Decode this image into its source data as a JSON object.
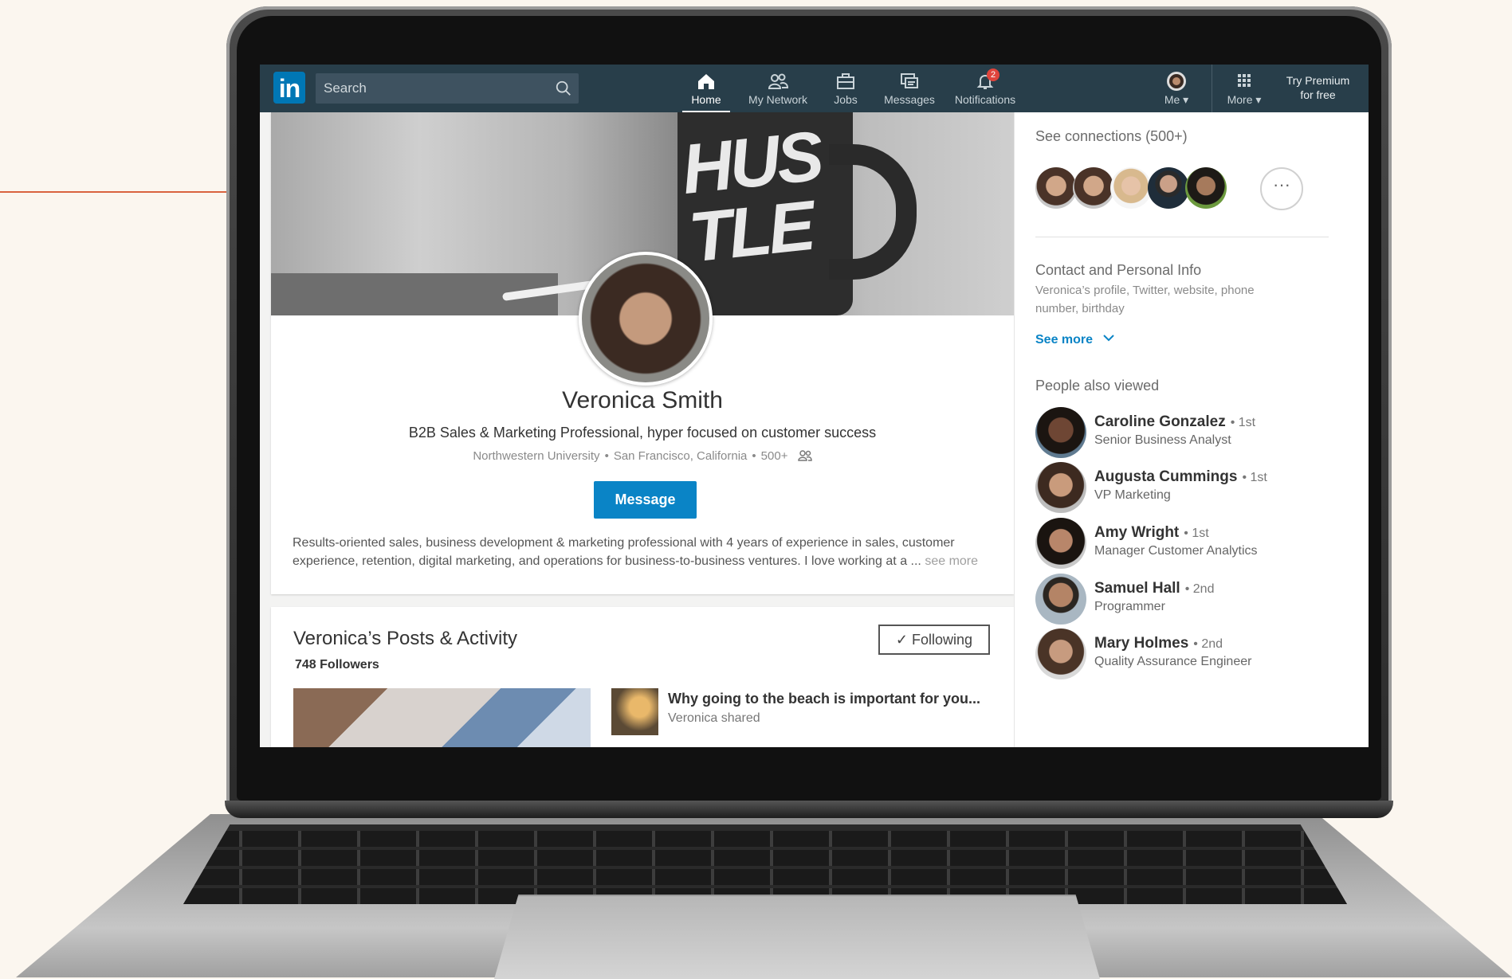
{
  "nav": {
    "logo": "in",
    "search_placeholder": "Search",
    "items": [
      {
        "label": "Home",
        "icon": "home-icon",
        "active": true
      },
      {
        "label": "My Network",
        "icon": "network-icon"
      },
      {
        "label": "Jobs",
        "icon": "jobs-icon"
      },
      {
        "label": "Messages",
        "icon": "messages-icon"
      },
      {
        "label": "Notifications",
        "icon": "bell-icon",
        "badge": "2"
      },
      {
        "label": "Me",
        "icon": "avatar"
      },
      {
        "label": "More",
        "icon": "grid-icon"
      }
    ],
    "premium_line1": "Try Premium",
    "premium_line2": "for free"
  },
  "profile": {
    "name": "Veronica Smith",
    "headline": "B2B Sales & Marketing Professional, hyper focused on customer success",
    "school": "Northwestern University",
    "location": "San Francisco, California",
    "connections": "500+",
    "message_button": "Message",
    "summary": "Results-oriented sales, business development & marketing professional with 4 years of experience in sales, customer experience, retention, digital marketing, and operations for business-to-business ventures. I love working at a ...",
    "see_more": "see more",
    "banner_text_1": "HUS",
    "banner_text_2": "TLE"
  },
  "activity": {
    "title": "Veronica’s Posts & Activity",
    "followers": "748 Followers",
    "following_button": "Following",
    "share_title": "Why going to the beach is important for you...",
    "share_sub": "Veronica shared"
  },
  "sidebar": {
    "connections_heading": "See connections (500+)",
    "more_glyph": "···",
    "contact_heading": "Contact and Personal Info",
    "contact_sub": "Veronica’s profile, Twitter, website, phone number, birthday",
    "see_more": "See more",
    "also_viewed_heading": "People also viewed",
    "people": [
      {
        "name": "Caroline Gonzalez",
        "degree": "• 1st",
        "title": "Senior Business Analyst"
      },
      {
        "name": "Augusta Cummings",
        "degree": "• 1st",
        "title": "VP Marketing"
      },
      {
        "name": "Amy Wright",
        "degree": "• 1st",
        "title": "Manager Customer Analytics"
      },
      {
        "name": "Samuel Hall",
        "degree": "• 2nd",
        "title": "Programmer"
      },
      {
        "name": "Mary Holmes",
        "degree": "• 2nd",
        "title": "Quality Assurance Engineer"
      }
    ]
  },
  "colors": {
    "nav_bg": "#283e4a",
    "brand_blue": "#0a84c6",
    "badge_red": "#e0443c",
    "pointer_orange": "#d9633f"
  }
}
